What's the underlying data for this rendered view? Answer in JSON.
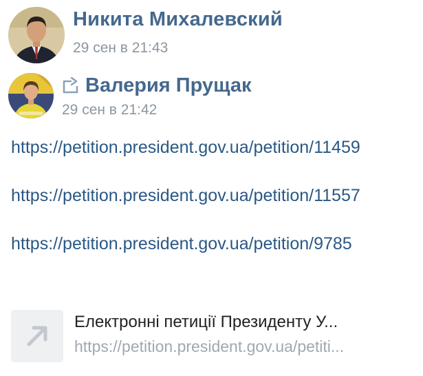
{
  "post": {
    "author_name": "Никита Михалевский",
    "author_time": "29 сен в 21:43"
  },
  "repost": {
    "author_name": "Валерия Прущак",
    "author_time": "29 сен в 21:42",
    "icon": "repost-arrow-icon"
  },
  "links": [
    "https://petition.president.gov.ua/petition/11459",
    "https://petition.president.gov.ua/petition/11557",
    "https://petition.president.gov.ua/petition/9785"
  ],
  "attachment": {
    "title": "Електронні петиції Президенту У...",
    "url": "https://petition.president.gov.ua/petiti...",
    "icon": "external-link-arrow-icon"
  },
  "colors": {
    "name": "#45688e",
    "link": "#2a5885",
    "meta": "#8c96a0"
  }
}
